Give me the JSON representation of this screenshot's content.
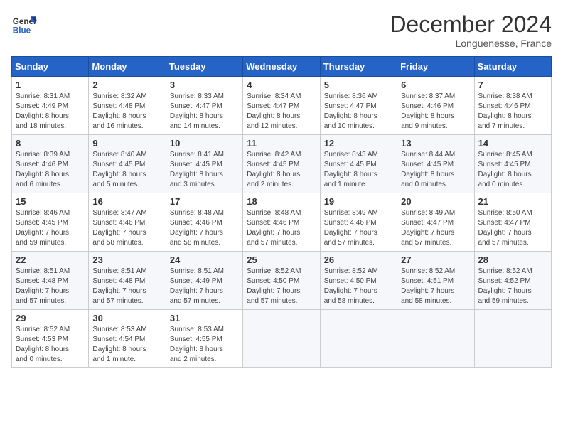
{
  "logo": {
    "line1": "General",
    "line2": "Blue"
  },
  "title": "December 2024",
  "location": "Longuenesse, France",
  "days_header": [
    "Sunday",
    "Monday",
    "Tuesday",
    "Wednesday",
    "Thursday",
    "Friday",
    "Saturday"
  ],
  "weeks": [
    [
      {
        "day": "1",
        "lines": [
          "Sunrise: 8:31 AM",
          "Sunset: 4:49 PM",
          "Daylight: 8 hours",
          "and 18 minutes."
        ]
      },
      {
        "day": "2",
        "lines": [
          "Sunrise: 8:32 AM",
          "Sunset: 4:48 PM",
          "Daylight: 8 hours",
          "and 16 minutes."
        ]
      },
      {
        "day": "3",
        "lines": [
          "Sunrise: 8:33 AM",
          "Sunset: 4:47 PM",
          "Daylight: 8 hours",
          "and 14 minutes."
        ]
      },
      {
        "day": "4",
        "lines": [
          "Sunrise: 8:34 AM",
          "Sunset: 4:47 PM",
          "Daylight: 8 hours",
          "and 12 minutes."
        ]
      },
      {
        "day": "5",
        "lines": [
          "Sunrise: 8:36 AM",
          "Sunset: 4:47 PM",
          "Daylight: 8 hours",
          "and 10 minutes."
        ]
      },
      {
        "day": "6",
        "lines": [
          "Sunrise: 8:37 AM",
          "Sunset: 4:46 PM",
          "Daylight: 8 hours",
          "and 9 minutes."
        ]
      },
      {
        "day": "7",
        "lines": [
          "Sunrise: 8:38 AM",
          "Sunset: 4:46 PM",
          "Daylight: 8 hours",
          "and 7 minutes."
        ]
      }
    ],
    [
      {
        "day": "8",
        "lines": [
          "Sunrise: 8:39 AM",
          "Sunset: 4:46 PM",
          "Daylight: 8 hours",
          "and 6 minutes."
        ]
      },
      {
        "day": "9",
        "lines": [
          "Sunrise: 8:40 AM",
          "Sunset: 4:45 PM",
          "Daylight: 8 hours",
          "and 5 minutes."
        ]
      },
      {
        "day": "10",
        "lines": [
          "Sunrise: 8:41 AM",
          "Sunset: 4:45 PM",
          "Daylight: 8 hours",
          "and 3 minutes."
        ]
      },
      {
        "day": "11",
        "lines": [
          "Sunrise: 8:42 AM",
          "Sunset: 4:45 PM",
          "Daylight: 8 hours",
          "and 2 minutes."
        ]
      },
      {
        "day": "12",
        "lines": [
          "Sunrise: 8:43 AM",
          "Sunset: 4:45 PM",
          "Daylight: 8 hours",
          "and 1 minute."
        ]
      },
      {
        "day": "13",
        "lines": [
          "Sunrise: 8:44 AM",
          "Sunset: 4:45 PM",
          "Daylight: 8 hours",
          "and 0 minutes."
        ]
      },
      {
        "day": "14",
        "lines": [
          "Sunrise: 8:45 AM",
          "Sunset: 4:45 PM",
          "Daylight: 8 hours",
          "and 0 minutes."
        ]
      }
    ],
    [
      {
        "day": "15",
        "lines": [
          "Sunrise: 8:46 AM",
          "Sunset: 4:45 PM",
          "Daylight: 7 hours",
          "and 59 minutes."
        ]
      },
      {
        "day": "16",
        "lines": [
          "Sunrise: 8:47 AM",
          "Sunset: 4:46 PM",
          "Daylight: 7 hours",
          "and 58 minutes."
        ]
      },
      {
        "day": "17",
        "lines": [
          "Sunrise: 8:48 AM",
          "Sunset: 4:46 PM",
          "Daylight: 7 hours",
          "and 58 minutes."
        ]
      },
      {
        "day": "18",
        "lines": [
          "Sunrise: 8:48 AM",
          "Sunset: 4:46 PM",
          "Daylight: 7 hours",
          "and 57 minutes."
        ]
      },
      {
        "day": "19",
        "lines": [
          "Sunrise: 8:49 AM",
          "Sunset: 4:46 PM",
          "Daylight: 7 hours",
          "and 57 minutes."
        ]
      },
      {
        "day": "20",
        "lines": [
          "Sunrise: 8:49 AM",
          "Sunset: 4:47 PM",
          "Daylight: 7 hours",
          "and 57 minutes."
        ]
      },
      {
        "day": "21",
        "lines": [
          "Sunrise: 8:50 AM",
          "Sunset: 4:47 PM",
          "Daylight: 7 hours",
          "and 57 minutes."
        ]
      }
    ],
    [
      {
        "day": "22",
        "lines": [
          "Sunrise: 8:51 AM",
          "Sunset: 4:48 PM",
          "Daylight: 7 hours",
          "and 57 minutes."
        ]
      },
      {
        "day": "23",
        "lines": [
          "Sunrise: 8:51 AM",
          "Sunset: 4:48 PM",
          "Daylight: 7 hours",
          "and 57 minutes."
        ]
      },
      {
        "day": "24",
        "lines": [
          "Sunrise: 8:51 AM",
          "Sunset: 4:49 PM",
          "Daylight: 7 hours",
          "and 57 minutes."
        ]
      },
      {
        "day": "25",
        "lines": [
          "Sunrise: 8:52 AM",
          "Sunset: 4:50 PM",
          "Daylight: 7 hours",
          "and 57 minutes."
        ]
      },
      {
        "day": "26",
        "lines": [
          "Sunrise: 8:52 AM",
          "Sunset: 4:50 PM",
          "Daylight: 7 hours",
          "and 58 minutes."
        ]
      },
      {
        "day": "27",
        "lines": [
          "Sunrise: 8:52 AM",
          "Sunset: 4:51 PM",
          "Daylight: 7 hours",
          "and 58 minutes."
        ]
      },
      {
        "day": "28",
        "lines": [
          "Sunrise: 8:52 AM",
          "Sunset: 4:52 PM",
          "Daylight: 7 hours",
          "and 59 minutes."
        ]
      }
    ],
    [
      {
        "day": "29",
        "lines": [
          "Sunrise: 8:52 AM",
          "Sunset: 4:53 PM",
          "Daylight: 8 hours",
          "and 0 minutes."
        ]
      },
      {
        "day": "30",
        "lines": [
          "Sunrise: 8:53 AM",
          "Sunset: 4:54 PM",
          "Daylight: 8 hours",
          "and 1 minute."
        ]
      },
      {
        "day": "31",
        "lines": [
          "Sunrise: 8:53 AM",
          "Sunset: 4:55 PM",
          "Daylight: 8 hours",
          "and 2 minutes."
        ]
      },
      null,
      null,
      null,
      null
    ]
  ]
}
